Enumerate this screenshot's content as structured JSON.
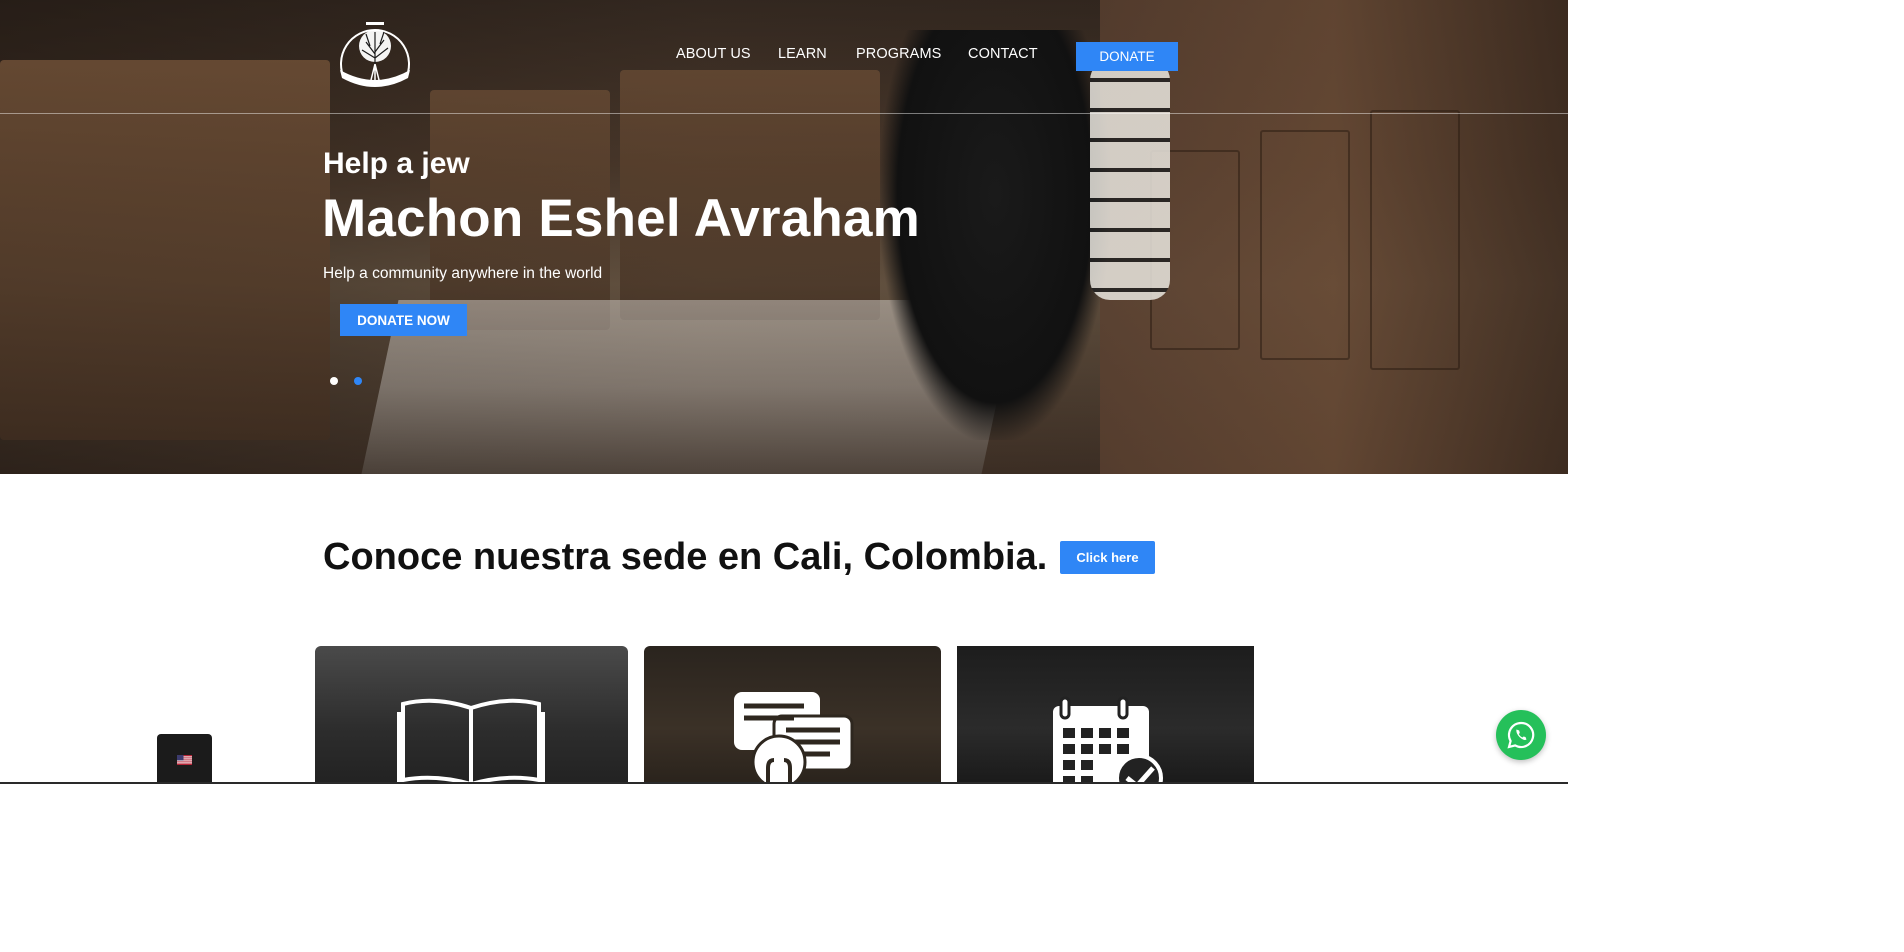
{
  "header": {
    "logo_alt": "Eshel Avraham tree logo",
    "nav": [
      {
        "label": "ABOUT US"
      },
      {
        "label": "LEARN"
      },
      {
        "label": "PROGRAMS"
      },
      {
        "label": "CONTACT"
      }
    ],
    "donate_label": "DONATE"
  },
  "hero": {
    "eyebrow": "Help a jew",
    "title": "Machon Eshel Avraham",
    "subtitle": "Help a community anywhere in the world",
    "cta_label": "DONATE NOW",
    "slides": 2,
    "active_slide": 2
  },
  "sede": {
    "title": "Conoce nuestra sede en Cali, Colombia.",
    "button_label": "Click here"
  },
  "cards": [
    {
      "icon": "open-book-icon"
    },
    {
      "icon": "chat-bubbles-lightbulb-icon"
    },
    {
      "icon": "calendar-check-icon"
    }
  ],
  "language": {
    "icon": "us-flag-icon"
  },
  "whatsapp": {
    "icon": "whatsapp-icon"
  },
  "colors": {
    "accent": "#2f86f6",
    "whatsapp": "#25c05a"
  }
}
